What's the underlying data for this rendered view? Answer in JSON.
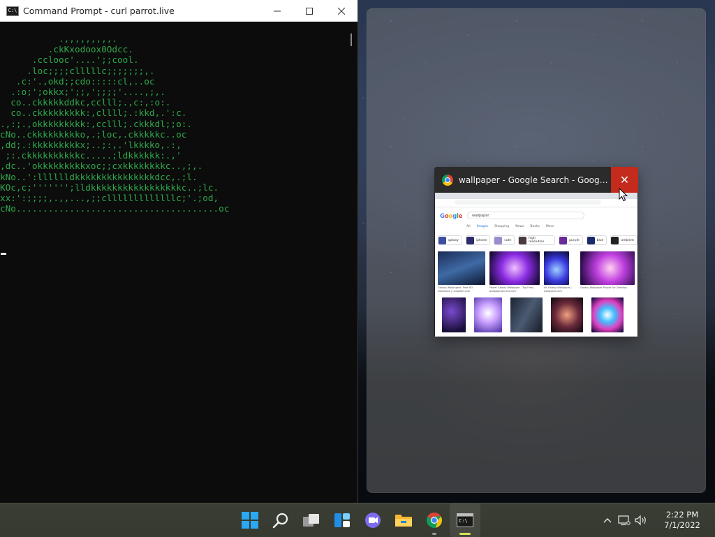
{
  "cmd_window": {
    "title": "Command Prompt - curl  parrot.live",
    "icon_label": "C:\\",
    "ascii_art": "           .,,,,,,,,,.\n         .ckKxodoox0Odcc.\n      .cclooc'....';;cool.\n     .loc;;;;clllllc;;;;;;;,.\n   .c:'.,okd;;cdo:::::cl,..oc\n  .:o;';okkx;';;,';;;;'....,;,.\n  co..ckkkkkddkc,cclll;.,c:,:o:.\n  co..ckkkkkkkkk:,cllll;.:kkd,.':c.\n.,:;.,okkkkkkkkk:,cclll;.ckkkdl;;o:.\ncNo..ckkkkkkkkko,.;loc,.ckkkkkc..oc\n,dd;.:kkkkkkkkkx;..;:,.'lkkkko,.:,\n ;:.ckkkkkkkkkkc.....;ldkkkkkk:.,'\n,dc..'okkkkkkkkkxoc;;cxkkkkkkkkc..,;,.\nkNo..':lllllldkkkkkkkkkkkkkkkdcc,.;l.\nKOc,c;''''''';lldkkkkkkkkkkkkkkkkkc..;lc.\nxx:':;;;;,.,,...,;;clllllllllllllc;'.;od,\ncNo......................................oc"
  },
  "snap_window": {
    "title": "wallpaper - Google Search - Google C...",
    "close_label": "✕",
    "preview": {
      "google_logo": [
        "G",
        "o",
        "o",
        "g",
        "l",
        "e"
      ],
      "query": "wallpaper",
      "tabs": [
        "All",
        "Images",
        "Shopping",
        "News",
        "Books",
        "More"
      ],
      "active_tab": "Images",
      "chips": [
        "galaxy",
        "iphone",
        "cute",
        "high resolution",
        "purple",
        "blue",
        "ambient"
      ],
      "row1_captions": [
        "Galaxy Wallpapers: Free HD Download | unsplash.com",
        "Planet Galaxy Wallpaper - Top Free | wallpaperaccess.com",
        "4K Galaxy Wallpaper | wallpaper.com",
        "Galaxy Wallpaper Purple For Desktop"
      ]
    }
  },
  "taskbar": {
    "apps": [
      "windows-start",
      "search",
      "task-view",
      "widgets",
      "teams-chat",
      "file-explorer",
      "chrome",
      "command-prompt"
    ],
    "clock_time": "2:22 PM",
    "clock_date": "7/1/2022",
    "tray_chevron": "^"
  },
  "colors": {
    "cmd_text": "#2fa84a",
    "close_red": "#c42b1c",
    "taskbar_bg": "#3a3d33",
    "active_indicator": "#d4e157"
  }
}
